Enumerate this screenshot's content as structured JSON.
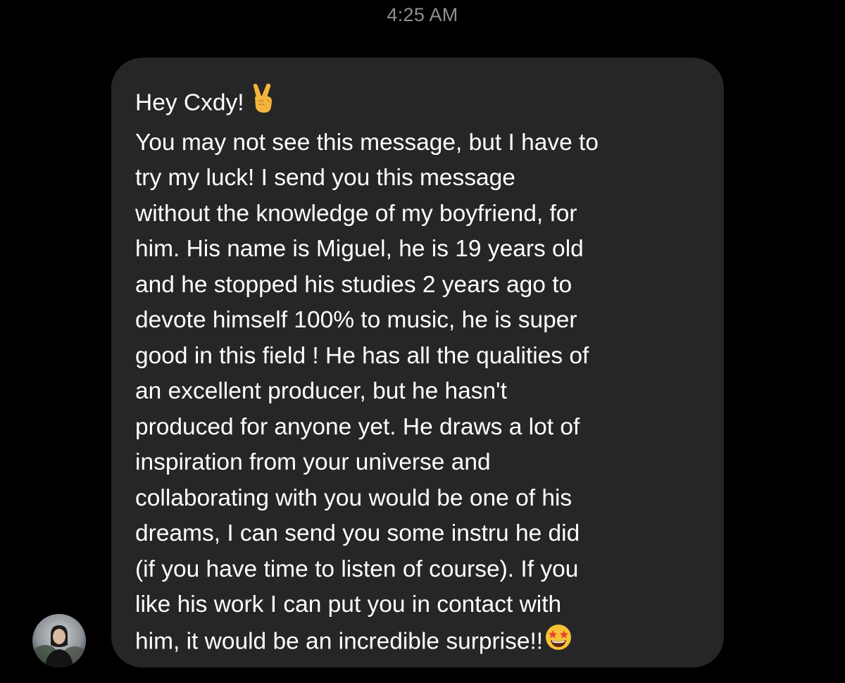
{
  "thread": {
    "timestamp": "4:25 AM"
  },
  "message": {
    "greeting": "Hey Cxdy!",
    "greeting_emoji": "victory-hand-emoji",
    "lines": [
      "You may not see this message, but I have to",
      "try my luck!  I send you this message",
      "without the knowledge of my boyfriend, for",
      "him. His name is Miguel, he is 19 years old",
      "and he stopped his studies 2 years ago to",
      "devote himself 100% to music, he is super",
      "good in this field ! He has all the qualities of",
      "an excellent producer, but he hasn't",
      "produced for anyone yet. He draws a lot of",
      "inspiration from your universe and",
      "collaborating with you would be one of his",
      "dreams, I can send you some instru he did",
      "(if you have time to listen of course). If you",
      "like his work I can put you in contact with"
    ],
    "last_line": "him, it would be an incredible surprise!!",
    "closing_emoji": "star-struck-emoji"
  },
  "sender": {
    "avatar_icon": "profile-avatar"
  },
  "colors": {
    "background": "#000000",
    "bubble": "#262626",
    "text": "#ffffff",
    "timestamp": "#8e8e93"
  }
}
